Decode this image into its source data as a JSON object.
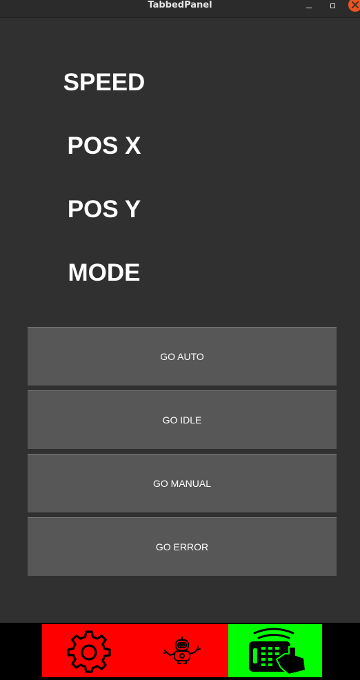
{
  "window": {
    "title": "TabbedPanel",
    "controls": [
      "minimize-icon",
      "maximize-icon",
      "close-icon"
    ],
    "close_color": "#e95420"
  },
  "status": {
    "speed_label": "SPEED",
    "pos_x_label": "POS X",
    "pos_y_label": "POS Y",
    "mode_label": "MODE"
  },
  "actions": {
    "go_auto": "GO AUTO",
    "go_idle": "GO IDLE",
    "go_manual": "GO MANUAL",
    "go_error": "GO ERROR"
  },
  "tabs": [
    {
      "icon": "gear-icon",
      "color": "#ff0000",
      "active": false
    },
    {
      "icon": "robot-icon",
      "color": "#ff0000",
      "active": false
    },
    {
      "icon": "remote-control-icon",
      "color": "#00ff00",
      "active": true
    }
  ]
}
